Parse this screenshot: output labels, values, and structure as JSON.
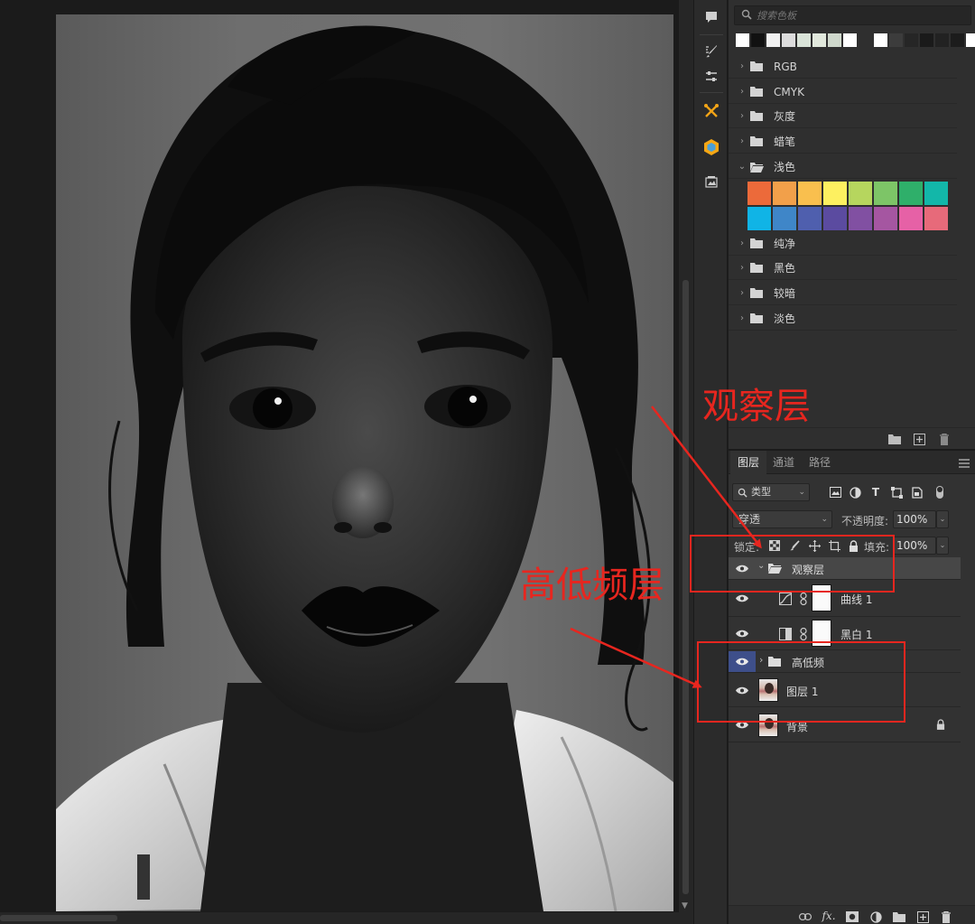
{
  "swatches": {
    "search_placeholder": "搜索色板",
    "recent_colors": [
      "#ffffff",
      "#111111",
      "#f2f2f2",
      "#dcdcdc",
      "#d9e3d8",
      "#e1e8dc",
      "#cfd8cc",
      "#ffffff",
      "#2f2f2f",
      "#ffffff",
      "#3c3c3c",
      "#262626",
      "#1a1a1a",
      "#222222",
      "#1c1c1c",
      "#ffffff",
      "#151515"
    ],
    "folders": [
      {
        "label": "RGB",
        "expanded": false
      },
      {
        "label": "CMYK",
        "expanded": false
      },
      {
        "label": "灰度",
        "expanded": false
      },
      {
        "label": "蜡笔",
        "expanded": false
      },
      {
        "label": "浅色",
        "expanded": true
      },
      {
        "label": "纯净",
        "expanded": false
      },
      {
        "label": "黑色",
        "expanded": false
      },
      {
        "label": "较暗",
        "expanded": false
      },
      {
        "label": "淡色",
        "expanded": false
      }
    ],
    "light_colors": [
      "#ec6a3a",
      "#f2a04a",
      "#f9bf4e",
      "#fdf060",
      "#b6d65e",
      "#7dc567",
      "#2faf6a",
      "#13b7a9",
      "#10b4e6",
      "#3f86c8",
      "#4f5fae",
      "#5b4ba0",
      "#8150a2",
      "#a556a1",
      "#e661a6",
      "#e76a7a"
    ]
  },
  "layers_panel": {
    "tabs": [
      "图层",
      "通道",
      "路径"
    ],
    "active_tab": 0,
    "filter_label": "类型",
    "blend_mode": "穿透",
    "opacity_label": "不透明度:",
    "opacity_value": "100%",
    "lock_label": "锁定:",
    "fill_label": "填充:",
    "fill_value": "100%",
    "layers": [
      {
        "name": "观察层",
        "type": "group",
        "expanded": true,
        "selected": true
      },
      {
        "name": "曲线 1",
        "type": "adjustment-curves"
      },
      {
        "name": "黑白 1",
        "type": "adjustment-bw"
      },
      {
        "name": "高低频",
        "type": "group",
        "expanded": false
      },
      {
        "name": "图层 1",
        "type": "pixel"
      },
      {
        "name": "背景",
        "type": "background",
        "locked": true
      }
    ],
    "bottom_actions": [
      "link-layers",
      "fx",
      "add-mask",
      "adjustment",
      "new-group",
      "new-layer",
      "delete"
    ]
  },
  "annotations": {
    "label_observe": "观察层",
    "label_freq": "高低频层",
    "color": "#e7261f"
  },
  "colors": {
    "accent_blue": "#3e4f8a",
    "panel_bg": "#323232"
  }
}
